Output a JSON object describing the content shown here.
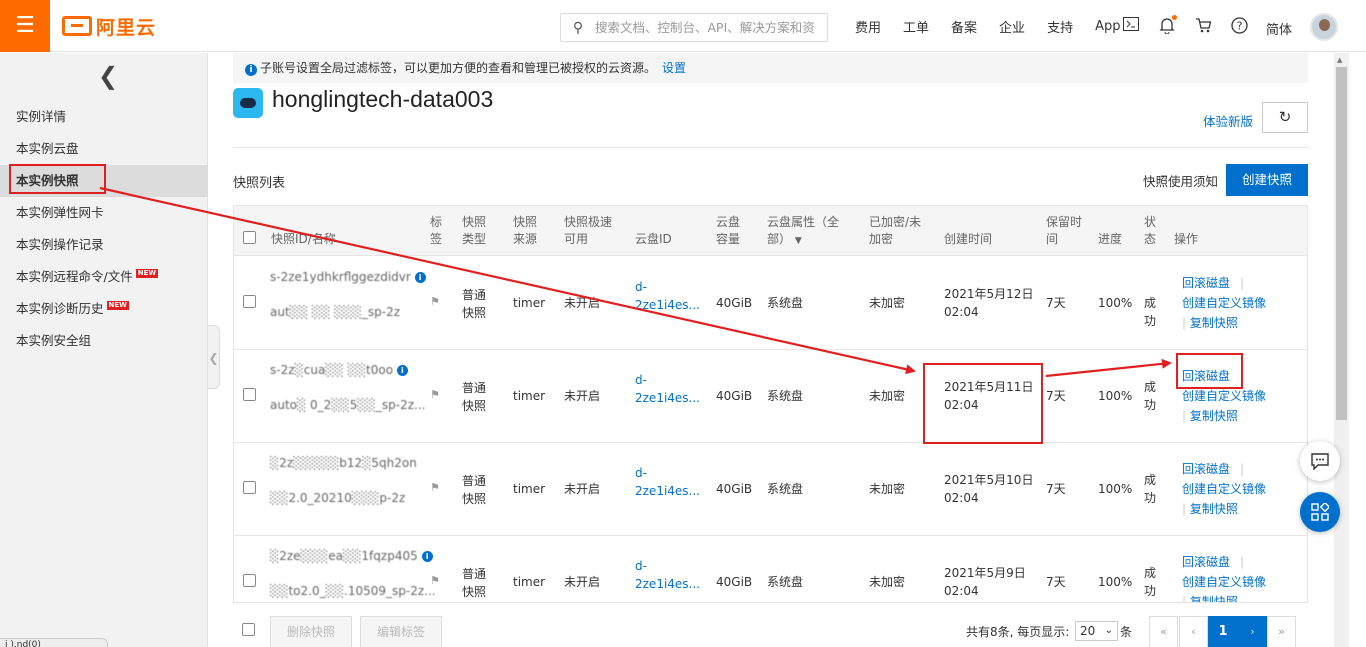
{
  "topbar": {
    "logo_text": "阿里云",
    "search_placeholder": "搜索文档、控制台、API、解决方案和资",
    "nav": [
      "费用",
      "工单",
      "备案",
      "企业",
      "支持",
      "App"
    ],
    "lang": "简体"
  },
  "sidebar": {
    "items": [
      {
        "label": "实例详情",
        "new": false
      },
      {
        "label": "本实例云盘",
        "new": false
      },
      {
        "label": "本实例快照",
        "new": false
      },
      {
        "label": "本实例弹性网卡",
        "new": false
      },
      {
        "label": "本实例操作记录",
        "new": false
      },
      {
        "label": "本实例远程命令/文件",
        "new": true
      },
      {
        "label": "本实例诊断历史",
        "new": true
      },
      {
        "label": "本实例安全组",
        "new": false
      }
    ],
    "new_badge": "NEW",
    "status_pill": "j                ).nd(0)"
  },
  "notice": {
    "text": "子账号设置全局过滤标签，可以更加方便的查看和管理已被授权的云资源。",
    "link": "设置"
  },
  "page": {
    "title": "honglingtech-data003",
    "new_version": "体验新版",
    "section_title": "快照列表",
    "usage_notice": "快照使用须知",
    "create_button": "创建快照"
  },
  "table": {
    "headers": {
      "id_name": "快照ID/名称",
      "tag": [
        "标",
        "签"
      ],
      "type": [
        "快照",
        "类型"
      ],
      "source": [
        "快照",
        "来源"
      ],
      "speed": [
        "快照极速",
        "可用"
      ],
      "disk_id": "云盘ID",
      "capacity": [
        "云盘",
        "容量"
      ],
      "attr": [
        "云盘属性（全",
        "部）"
      ],
      "encrypted": [
        "已加密/未",
        "加密"
      ],
      "created": "创建时间",
      "retention": [
        "保留时",
        "间"
      ],
      "progress": "进度",
      "status": [
        "状",
        "态"
      ],
      "ops": "操作"
    },
    "rows": [
      {
        "id": "s-2ze1ydhkrflggezdidvr",
        "name": "aut░░ ░░ ░░░_sp-2z",
        "type": [
          "普通",
          "快照"
        ],
        "source": "timer",
        "speed": "未开启",
        "disk": [
          "d-",
          "2ze1i4es..."
        ],
        "capacity": "40GiB",
        "attr": "系统盘",
        "enc": "未加密",
        "created": [
          "2021年5月12日",
          "02:04"
        ],
        "retention": "7天",
        "progress": "100%",
        "status": [
          "成",
          "功"
        ]
      },
      {
        "id": "s-2z░cua░░ ░░t0oo",
        "name": "auto░ 0_2░░5░░_sp-2z...",
        "type": [
          "普通",
          "快照"
        ],
        "source": "timer",
        "speed": "未开启",
        "disk": [
          "d-",
          "2ze1i4es..."
        ],
        "capacity": "40GiB",
        "attr": "系统盘",
        "enc": "未加密",
        "created": [
          "2021年5月11日",
          "02:04"
        ],
        "retention": "7天",
        "progress": "100%",
        "status": [
          "成",
          "功"
        ]
      },
      {
        "id": "░2z░░░░░b12░5qh2on",
        "name": "░░2.0_20210░░░p-2z",
        "type": [
          "普通",
          "快照"
        ],
        "source": "timer",
        "speed": "未开启",
        "disk": [
          "d-",
          "2ze1i4es..."
        ],
        "capacity": "40GiB",
        "attr": "系统盘",
        "enc": "未加密",
        "created": [
          "2021年5月10日",
          "02:04"
        ],
        "retention": "7天",
        "progress": "100%",
        "status": [
          "成",
          "功"
        ]
      },
      {
        "id": "░2ze░░░ea░░1fqzp405",
        "name": "░░to2.0_░░.10509_sp-2z...",
        "type": [
          "普通",
          "快照"
        ],
        "source": "timer",
        "speed": "未开启",
        "disk": [
          "d-",
          "2ze1i4es..."
        ],
        "capacity": "40GiB",
        "attr": "系统盘",
        "enc": "未加密",
        "created": [
          "2021年5月9日",
          "02:04"
        ],
        "retention": "7天",
        "progress": "100%",
        "status": [
          "成",
          "功"
        ]
      }
    ],
    "ops": {
      "rollback": "回滚磁盘",
      "custom_image": "创建自定义镜像",
      "copy": "复制快照"
    }
  },
  "footer": {
    "delete": "删除快照",
    "edit_tags": "编辑标签",
    "total": "共有8条, 每页显示:",
    "page_size": "20",
    "unit": "条",
    "current_page": "1"
  },
  "colors": {
    "brand": "#ff6a00",
    "link": "#0070cc",
    "annotation": "#e02020"
  }
}
